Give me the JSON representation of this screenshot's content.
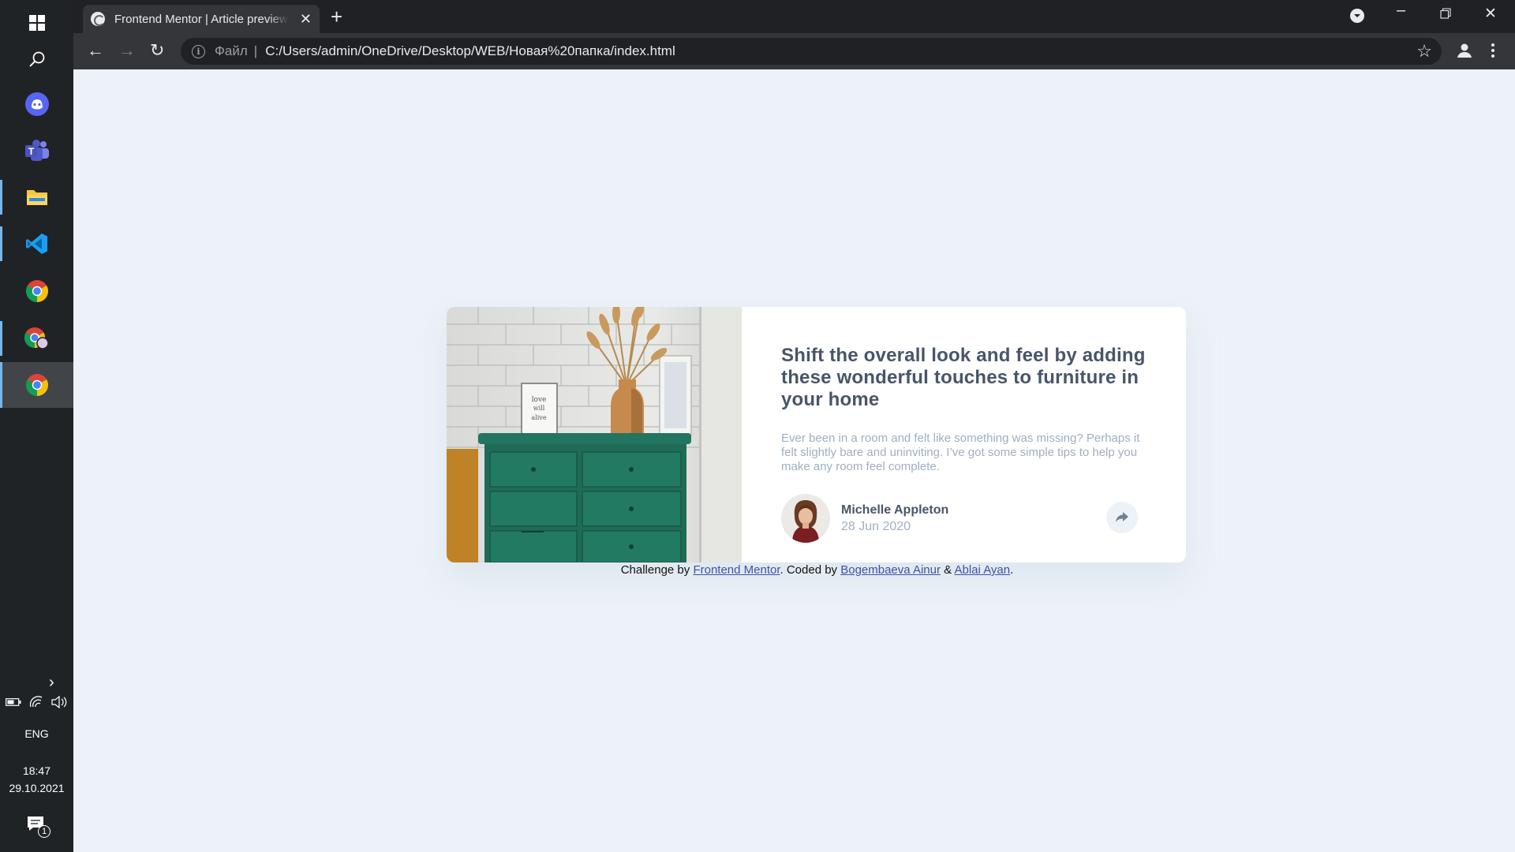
{
  "taskbar": {
    "icons": [
      "windows-start-icon",
      "search-icon",
      "discord-icon",
      "teams-icon",
      "file-explorer-icon",
      "vscode-icon",
      "chrome-icon",
      "chrome-canary-icon",
      "chrome-active-icon"
    ],
    "language": "ENG",
    "time": "18:47",
    "date": "29.10.2021",
    "notification_count": "1"
  },
  "browser": {
    "tab_title": "Frontend Mentor | Article preview component",
    "address_prefix": "Файл",
    "address_separator": "|",
    "url": "C:/Users/admin/OneDrive/Desktop/WEB/Новая%20папка/index.html"
  },
  "article": {
    "title": "Shift the overall look and feel by adding these wonderful touches to furniture in your home",
    "description": "Ever been in a room and felt like something was missing? Perhaps it felt slightly bare and uninviting. I’ve got some simple tips to help you make any room feel complete.",
    "author_name": "Michelle Appleton",
    "date": "28 Jun 2020"
  },
  "attribution": {
    "challenge_prefix": "Challenge by ",
    "frontend_mentor": "Frontend Mentor",
    "coded_by": ". Coded by ",
    "author1": "Bogembaeva Ainur",
    "and": " & ",
    "author2": "Ablai Ayan",
    "end": "."
  },
  "colors": {
    "page_bg": "#ecf2f8",
    "title": "#48556a",
    "text_muted": "#9eafc2",
    "link": "#3e52a3"
  }
}
